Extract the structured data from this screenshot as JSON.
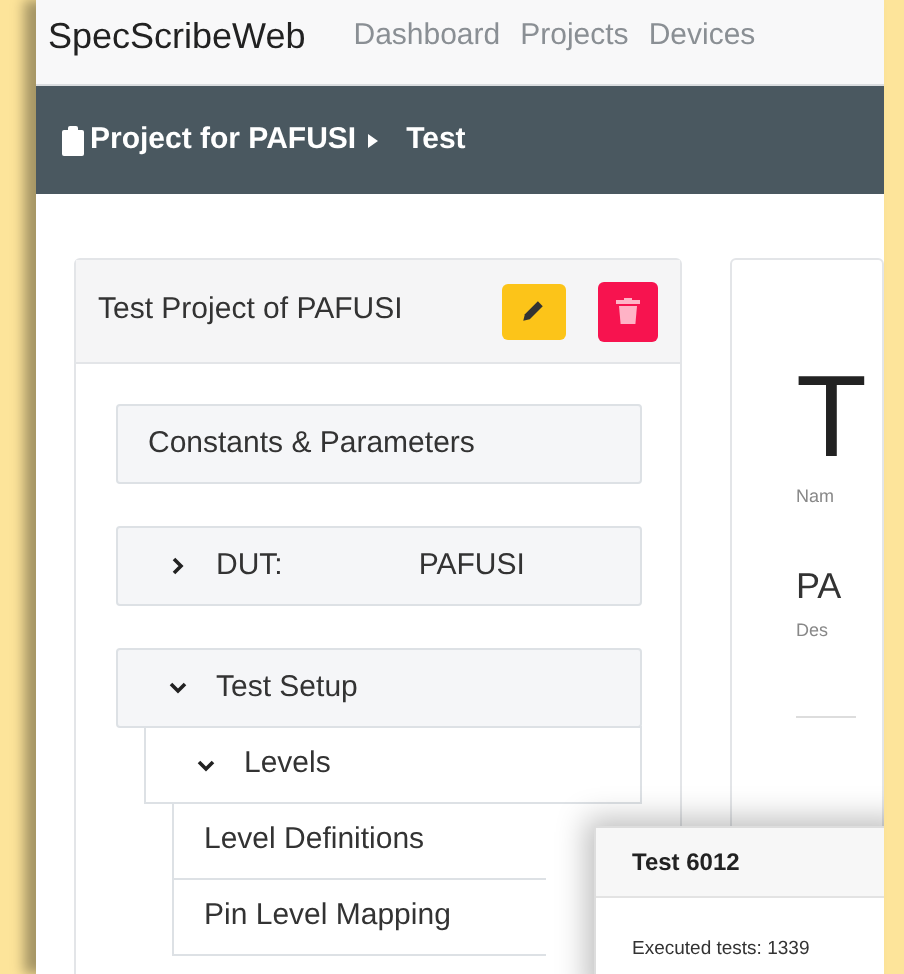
{
  "navbar": {
    "brand": "SpecScribeWeb",
    "links": [
      {
        "label": "Dashboard"
      },
      {
        "label": "Projects"
      },
      {
        "label": "Devices"
      }
    ]
  },
  "breadcrumb": [
    {
      "label": "Project for PAFUSI"
    },
    {
      "label": "Test"
    }
  ],
  "project_card": {
    "title": "Test Project of PAFUSI",
    "tree": [
      {
        "label": "Constants & Parameters"
      },
      {
        "label": "DUT:",
        "value": "PAFUSI",
        "expanded": false
      },
      {
        "label": "Test Setup",
        "expanded": true,
        "children": [
          {
            "label": "Levels",
            "expanded": true,
            "children": [
              {
                "label": "Level Definitions"
              },
              {
                "label": "Pin Level Mapping"
              }
            ]
          }
        ]
      }
    ]
  },
  "detail_card": {
    "heading": "T",
    "heading_caption": "Nam",
    "subheading": "PA",
    "subheading_caption": "Des"
  },
  "popup": {
    "title": "Test 6012",
    "text": "Executed tests: 1339"
  }
}
